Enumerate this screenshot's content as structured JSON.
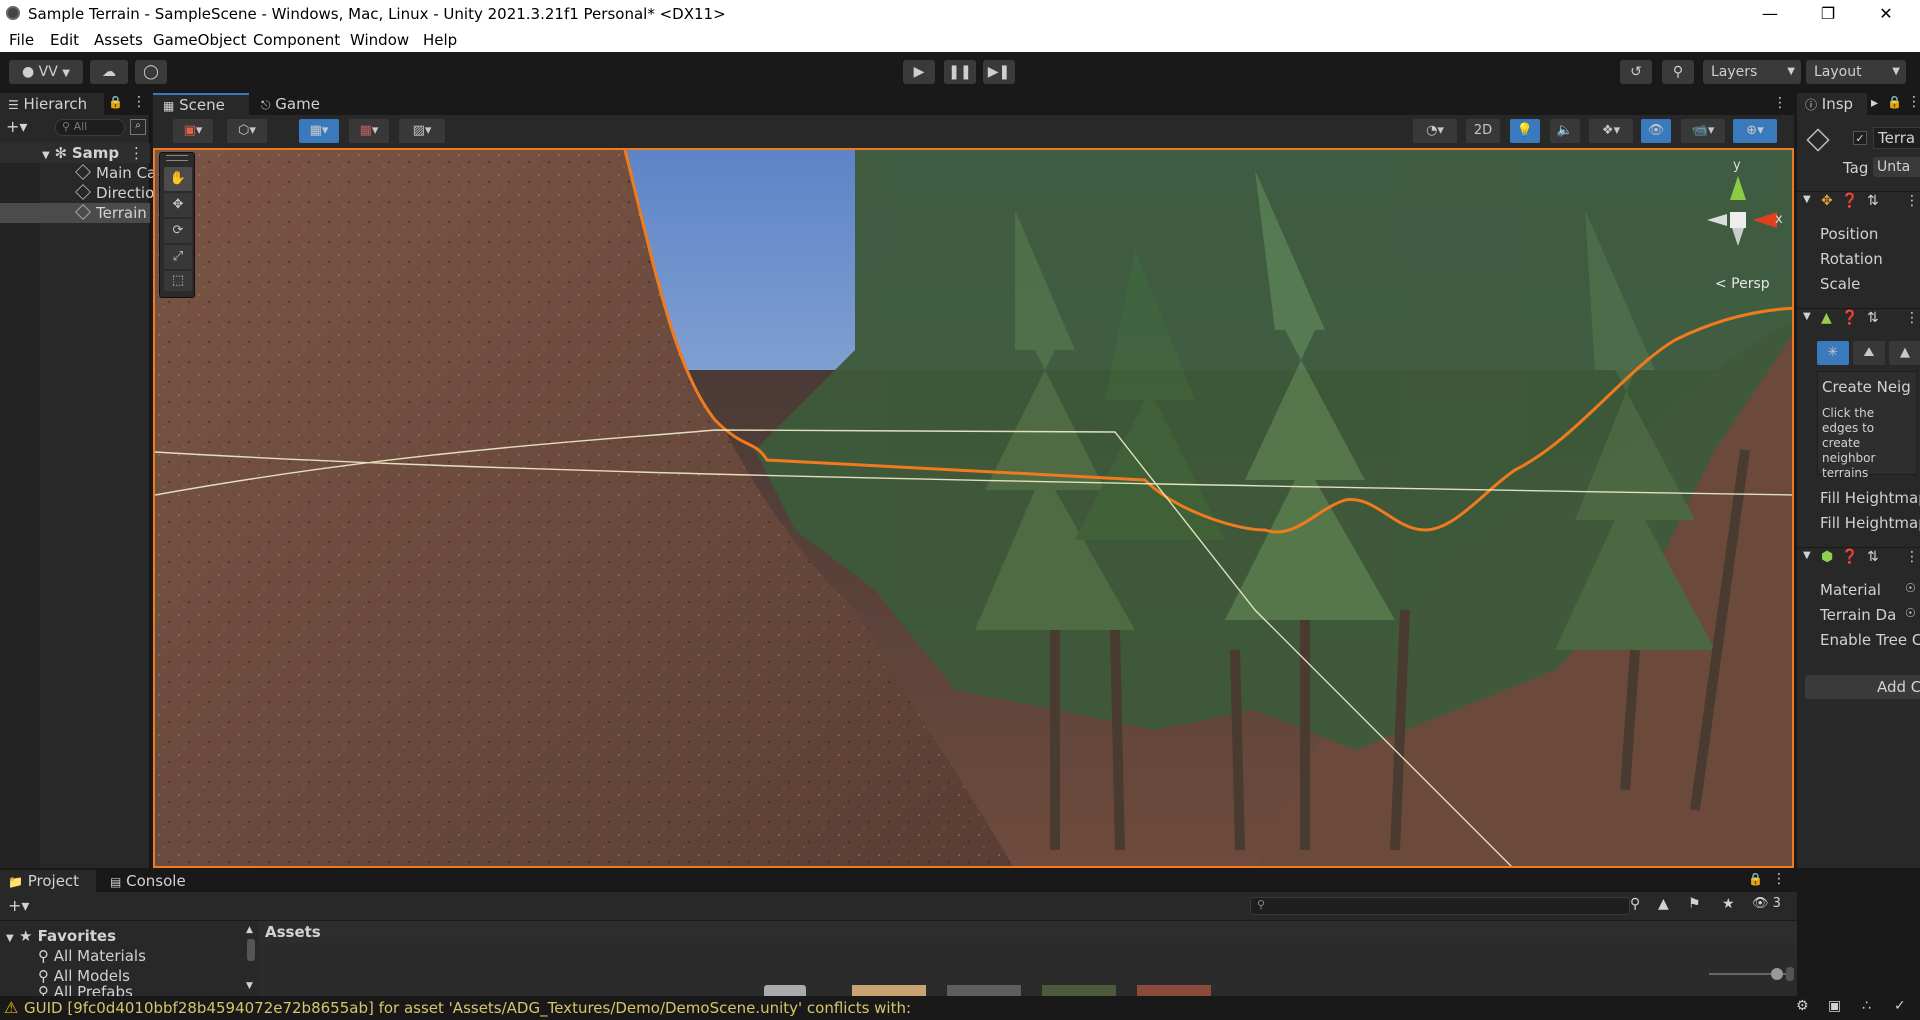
{
  "window": {
    "title": "Sample Terrain - SampleScene - Windows, Mac, Linux - Unity 2021.3.21f1 Personal* <DX11>"
  },
  "menu": [
    "File",
    "Edit",
    "Assets",
    "GameObject",
    "Component",
    "Window",
    "Help"
  ],
  "toolbar": {
    "account": "VV",
    "layers": "Layers",
    "layout": "Layout"
  },
  "hierarchy": {
    "tab": "Hierarch",
    "search_placeholder": "All",
    "scene": "Samp",
    "items": [
      "Main Ca",
      "Directio",
      "Terrain"
    ]
  },
  "scene_tabs": {
    "scene": "Scene",
    "game": "Game"
  },
  "scene_toolbar": {
    "two_d": "2D"
  },
  "gizmo": {
    "y": "y",
    "x": "x",
    "persp": "< Persp"
  },
  "inspector": {
    "tab": "Insp",
    "object_name": "Terra",
    "tag_label": "Tag",
    "tag_value": "Unta",
    "transform": [
      "Position",
      "Rotation",
      "Scale"
    ],
    "terrain_tool_title": "Create Neig",
    "terrain_tool_help": [
      "Click the",
      "edges to",
      "create",
      "neighbor",
      "terrains"
    ],
    "fill_heightmap_1": "Fill Heightmap",
    "fill_heightmap_2": "Fill Heightmap",
    "collider": [
      "Material",
      "Terrain Da",
      "Enable Tree C"
    ],
    "add_component": "Add C"
  },
  "bottom": {
    "tabs": [
      "Project",
      "Console"
    ],
    "favorites_label": "Favorites",
    "favorites": [
      "All Materials",
      "All Models",
      "All Prefabs"
    ],
    "assets_label": "Assets",
    "hidden_count": "3"
  },
  "status": {
    "message": "GUID [9fc0d4010bbf28b4594072e72b8655ab] for asset 'Assets/ADG_Textures/Demo/DemoScene.unity' conflicts with:"
  },
  "colors": {
    "selection_outline": "#f07a1e",
    "accent_blue": "#3a79bb"
  }
}
